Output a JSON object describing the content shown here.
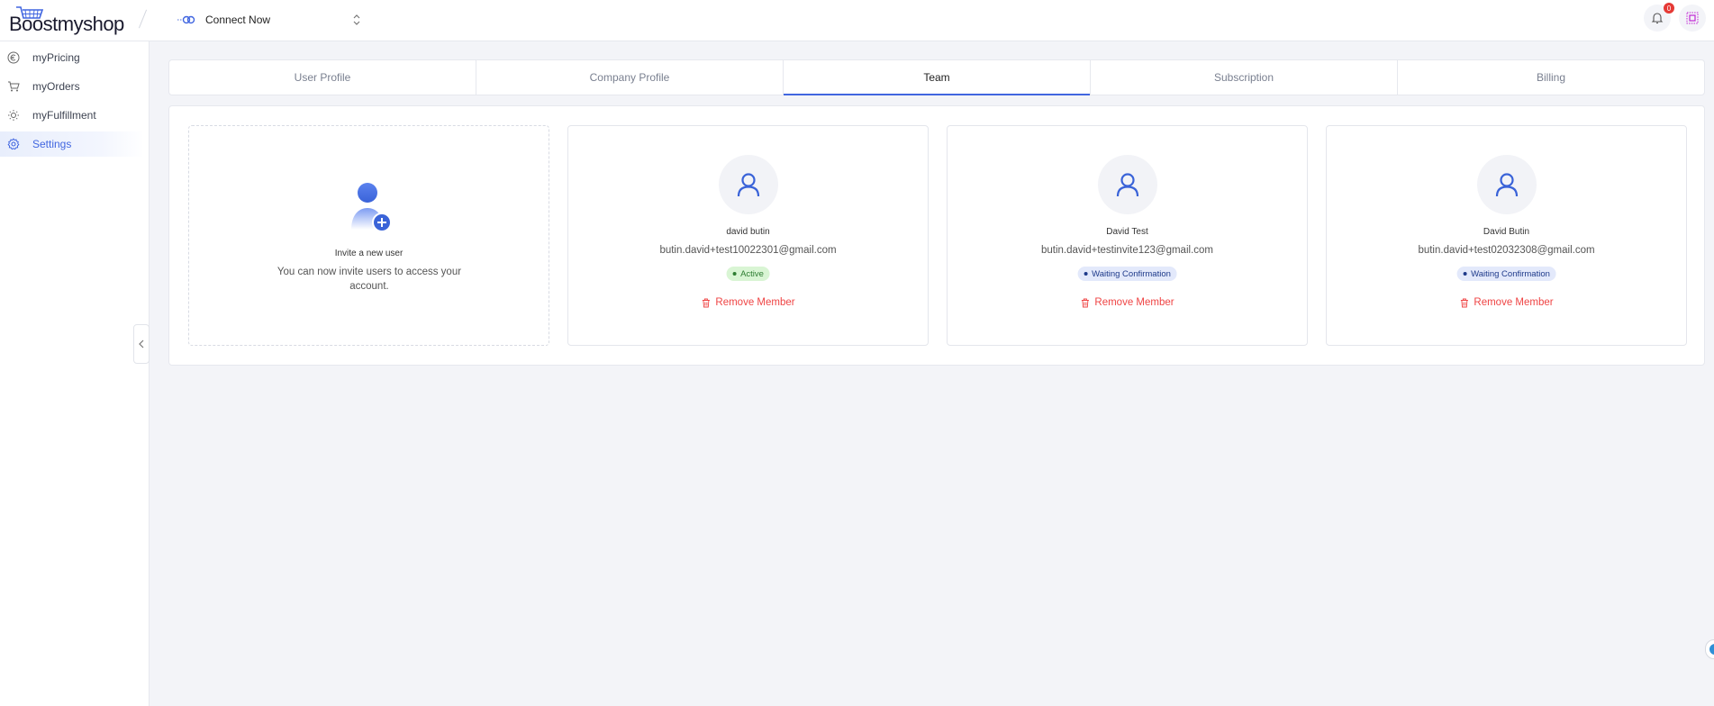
{
  "header": {
    "logo_text": "Boostmyshop",
    "connect_label": "Connect Now",
    "notification_count": "0",
    "icons": {
      "connect": "connect-link-icon",
      "switch": "chevron-up-down-icon",
      "bell": "bell-icon",
      "apps": "apps-icon"
    }
  },
  "sidebar": {
    "items": [
      {
        "label": "myPricing",
        "icon": "euro-icon",
        "active": false
      },
      {
        "label": "myOrders",
        "icon": "cart-icon",
        "active": false
      },
      {
        "label": "myFulfillment",
        "icon": "sun-icon",
        "active": false
      },
      {
        "label": "Settings",
        "icon": "gear-icon",
        "active": true
      }
    ]
  },
  "tabs": [
    {
      "label": "User Profile",
      "active": false
    },
    {
      "label": "Company Profile",
      "active": false
    },
    {
      "label": "Team",
      "active": true
    },
    {
      "label": "Subscription",
      "active": false
    },
    {
      "label": "Billing",
      "active": false
    }
  ],
  "invite": {
    "title": "Invite a new user",
    "description": "You can now invite users to access your account."
  },
  "members": [
    {
      "name": "david butin",
      "email": "butin.david+test10022301@gmail.com",
      "status": "Active",
      "status_type": "active",
      "remove_label": "Remove Member"
    },
    {
      "name": "David Test",
      "email": "butin.david+testinvite123@gmail.com",
      "status": "Waiting Confirmation",
      "status_type": "waiting",
      "remove_label": "Remove Member"
    },
    {
      "name": "David Butin",
      "email": "butin.david+test02032308@gmail.com",
      "status": "Waiting Confirmation",
      "status_type": "waiting",
      "remove_label": "Remove Member"
    }
  ],
  "colors": {
    "accent": "#4166e0",
    "danger": "#ef4444",
    "active_badge_bg": "#d9f5d4",
    "waiting_badge_bg": "#e3e9fb",
    "page_bg": "#f3f4f8"
  }
}
